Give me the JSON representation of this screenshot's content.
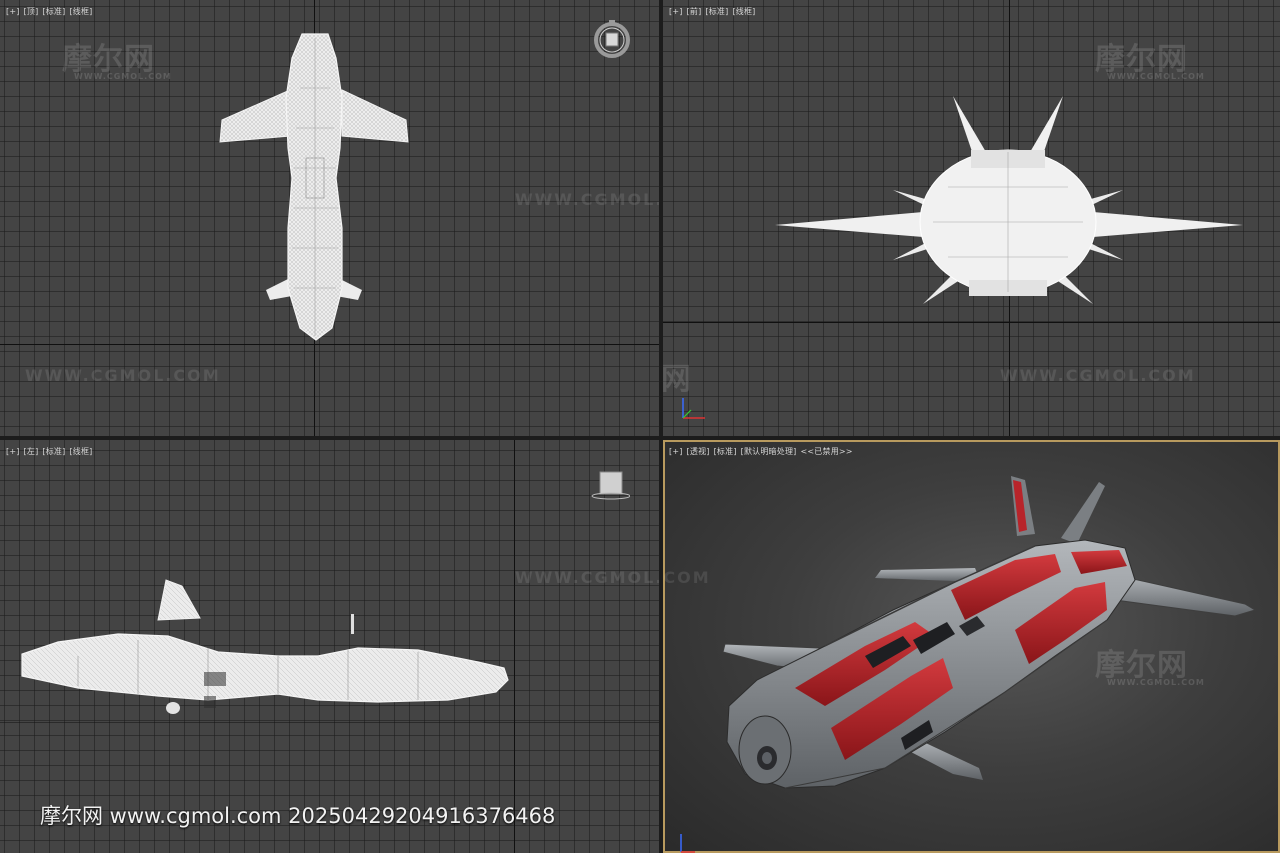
{
  "viewports": {
    "top": {
      "labels": [
        "[+]",
        "[顶]",
        "[标准]",
        "[线框]"
      ]
    },
    "front": {
      "labels": [
        "[+]",
        "[前]",
        "[标准]",
        "[线框]"
      ]
    },
    "left": {
      "labels": [
        "[+]",
        "[左]",
        "[标准]",
        "[线框]"
      ]
    },
    "perspective": {
      "labels": [
        "[+]",
        "[透视]",
        "[标准]",
        "[默认明暗处理]",
        "<<已禁用>>"
      ]
    }
  },
  "watermark": {
    "cn": "摩尔网",
    "en": "WWW.CGMOL.COM",
    "sub": "WWW.CGMOL.COM",
    "bottom_text": "摩尔网 www.cgmol.com 20250429204916376468"
  },
  "colors": {
    "viewport_bg": "#444444",
    "grid_line": "#2a2a2a",
    "wireframe": "#e6e6e6",
    "ship_red": "#b8242a",
    "ship_gray": "#8a8e92",
    "active_border": "#b89a5e"
  },
  "icons": {
    "viewcube_top": "viewcube-icon",
    "viewcube_left": "viewcube-icon",
    "axis_tripod": "axis-tripod-icon"
  }
}
